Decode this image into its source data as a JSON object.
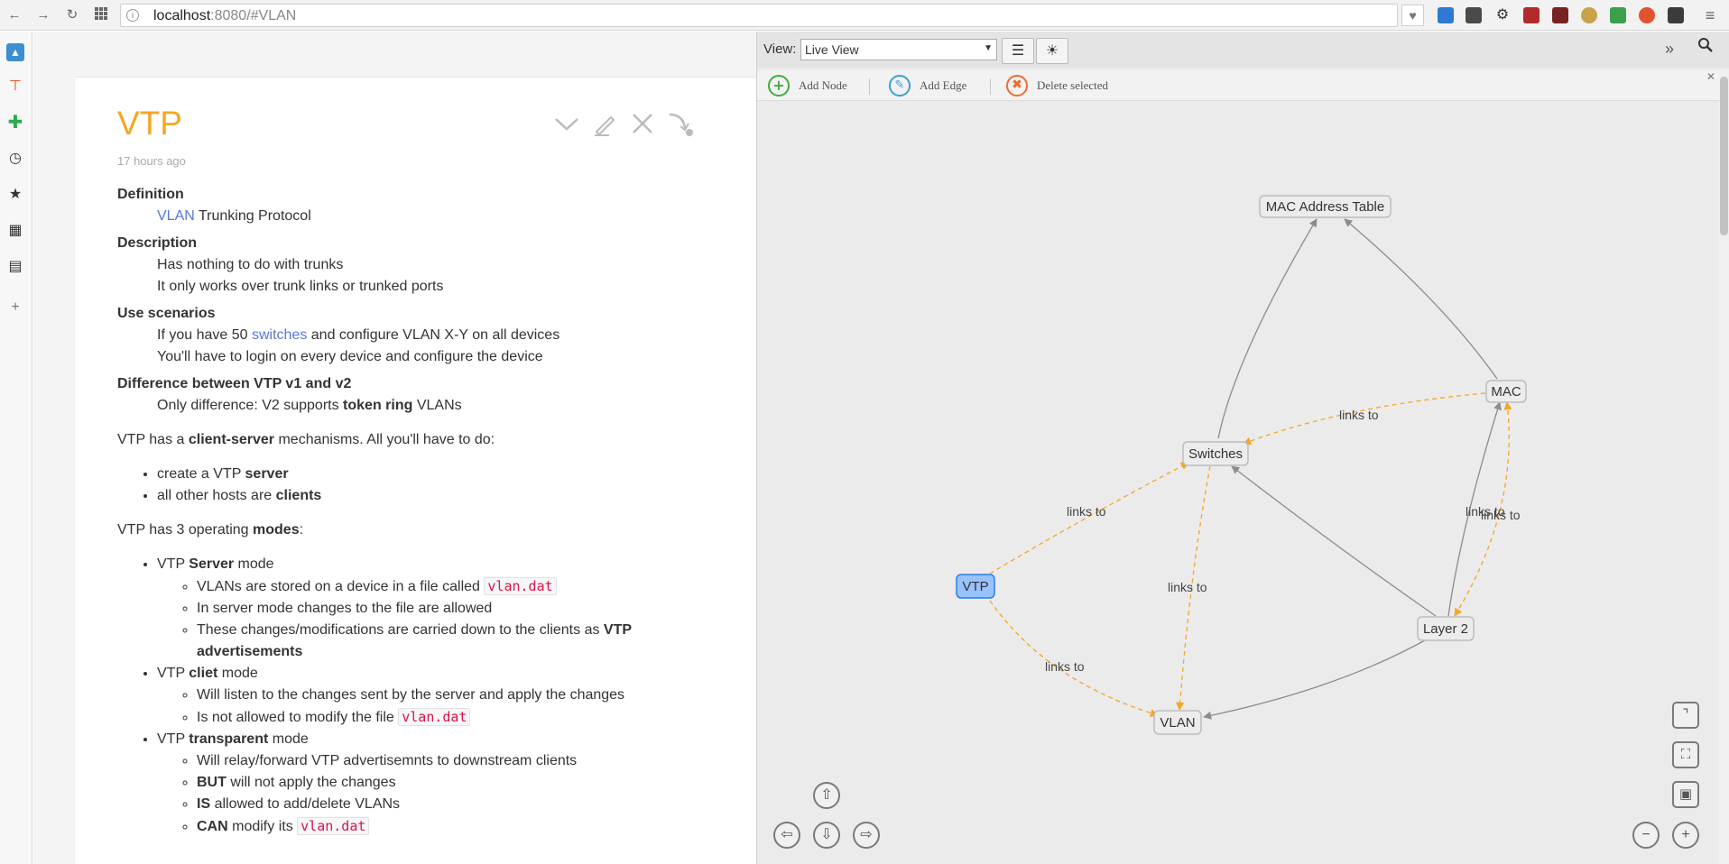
{
  "browser": {
    "url_host": "localhost",
    "url_rest": ":8080/#VLAN"
  },
  "tiddler": {
    "title": "VTP",
    "age": "17 hours ago"
  },
  "note": {
    "definition_term": "Definition",
    "definition_link": "VLAN",
    "definition_rest": " Trunking Protocol",
    "description_term": "Description",
    "description_1": "Has nothing to do with trunks",
    "description_2": "It only works over trunk links or trunked ports",
    "use_term": "Use scenarios",
    "use_1_pre": "If you have 50 ",
    "use_1_link": "switches",
    "use_1_post": " and configure VLAN X-Y on all devices",
    "use_2": "You'll have to login on every device and configure the device",
    "diff_term": "Difference between VTP v1 and v2",
    "diff_pre": "Only difference: V2 supports ",
    "diff_bold": "token ring",
    "diff_post": " VLANs",
    "para1_pre": "VTP has a ",
    "para1_bold": "client-server",
    "para1_post": " mechanisms. All you'll have to do:",
    "list1_a_pre": "create a VTP ",
    "list1_a_bold": "server",
    "list1_b_pre": "all other hosts are ",
    "list1_b_bold": "clients",
    "para2_pre": "VTP has 3 operating ",
    "para2_bold": "modes",
    "para2_post": ":",
    "server_pre": "VTP ",
    "server_bold": "Server",
    "server_post": " mode",
    "server_1_pre": "VLANs are stored on a device in a file called ",
    "server_1_code": "vlan.dat",
    "server_2": "In server mode changes to the file are allowed",
    "server_3_pre": "These changes/modifications are carried down to the clients as ",
    "server_3_bold": "VTP advertisements",
    "client_pre": "VTP ",
    "client_bold": "cliet",
    "client_post": " mode",
    "client_1": "Will listen to the changes sent by the server and apply the changes",
    "client_2_pre": "Is not allowed to modify the file ",
    "client_2_code": "vlan.dat",
    "transparent_pre": "VTP ",
    "transparent_bold": "transparent",
    "transparent_post": " mode",
    "transparent_1": "Will relay/forward VTP advertisemnts to downstream clients",
    "transparent_2_bold": "BUT",
    "transparent_2_post": " will not apply the changes",
    "transparent_3_bold": "IS",
    "transparent_3_post": " allowed to add/delete VLANs",
    "transparent_4_bold": "CAN",
    "transparent_4_post": " modify its ",
    "transparent_4_code": "vlan.dat"
  },
  "graph": {
    "view_label": "View:",
    "view_value": "Live View",
    "toolbar": {
      "add_node": "Add Node",
      "add_edge": "Add Edge",
      "delete_selected": "Delete selected"
    },
    "nodes": [
      {
        "id": "mac_table",
        "label": "MAC Address Table",
        "selected": false
      },
      {
        "id": "mac",
        "label": "MAC",
        "selected": false
      },
      {
        "id": "switches",
        "label": "Switches",
        "selected": false
      },
      {
        "id": "vtp",
        "label": "VTP",
        "selected": true
      },
      {
        "id": "layer2",
        "label": "Layer 2",
        "selected": false
      },
      {
        "id": "vlan",
        "label": "VLAN",
        "selected": false
      }
    ],
    "edges": [
      {
        "from": "switches",
        "to": "mac_table",
        "label": "",
        "style": "solid"
      },
      {
        "from": "mac",
        "to": "mac_table",
        "label": "",
        "style": "solid"
      },
      {
        "from": "mac",
        "to": "switches",
        "label": "links to",
        "style": "dashed"
      },
      {
        "from": "vtp",
        "to": "switches",
        "label": "links to",
        "style": "dashed"
      },
      {
        "from": "switches",
        "to": "vlan",
        "label": "links to",
        "style": "dashed"
      },
      {
        "from": "vtp",
        "to": "vlan",
        "label": "links to",
        "style": "dashed"
      },
      {
        "from": "layer2",
        "to": "switches",
        "label": "",
        "style": "solid"
      },
      {
        "from": "layer2",
        "to": "mac",
        "label": "links to",
        "style": "solid"
      },
      {
        "from": "mac",
        "to": "layer2",
        "label": "links to",
        "style": "dashed"
      },
      {
        "from": "layer2",
        "to": "vlan",
        "label": "",
        "style": "solid"
      }
    ],
    "colors": {
      "dashed_edge": "#f5a623",
      "solid_edge": "#8c8c8c",
      "selected_node": "#97c2fc",
      "add_node": "#3cae3c",
      "add_edge": "#3b9fd6",
      "delete": "#ee6b2f"
    },
    "icons": {
      "menu": "list-icon",
      "theme": "sun-icon",
      "expand": "double-chevron-icon",
      "search": "search-icon"
    }
  },
  "accent_color": "#f5a623"
}
